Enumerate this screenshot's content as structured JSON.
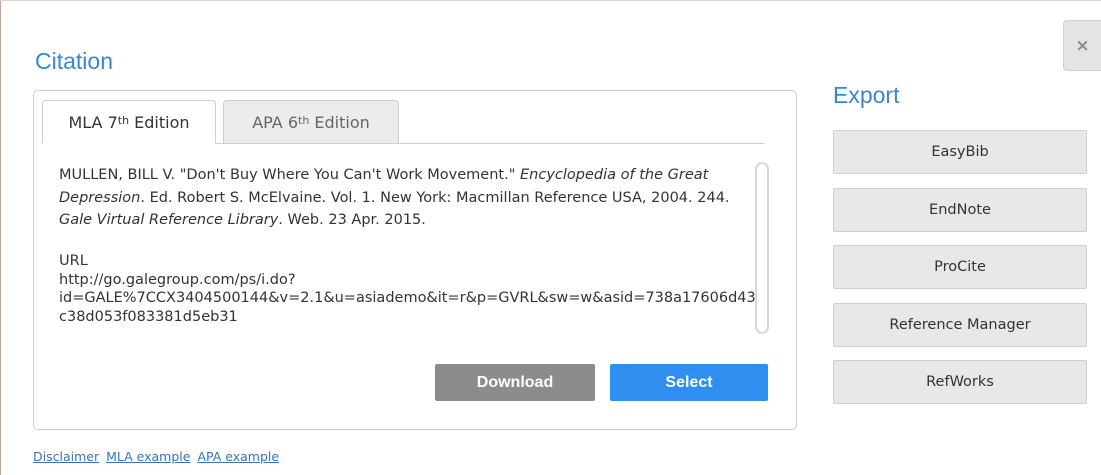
{
  "window": {
    "close_label": "×"
  },
  "citation": {
    "title": "Citation",
    "tabs": [
      {
        "label": "MLA 7",
        "sup": "th",
        "suffix": " Edition",
        "active": true
      },
      {
        "label": "APA 6",
        "sup": "th",
        "suffix": " Edition",
        "active": false
      }
    ],
    "text": {
      "part1": "MULLEN, BILL V. \"Don't Buy Where You Can't Work Movement.\" ",
      "italic1": "Encyclopedia of the Great Depression",
      "part2": ". Ed. Robert S. McElvaine. Vol. 1. New York: Macmillan Reference USA, 2004. 244. ",
      "italic2": "Gale Virtual Reference Library",
      "part3": ". Web. 23 Apr. 2015."
    },
    "url_label": "URL",
    "url_line1": "http://go.galegroup.com/ps/i.do?",
    "url_line2": "id=GALE%7CCX3404500144&v=2.1&u=asiademo&it=r&p=GVRL&sw=w&asid=738a17606d43c38d053f083381d5eb31",
    "download_label": "Download",
    "select_label": "Select"
  },
  "export": {
    "title": "Export",
    "buttons": [
      "EasyBib",
      "EndNote",
      "ProCite",
      "Reference Manager",
      "RefWorks"
    ]
  },
  "footer": {
    "links": [
      "Disclaimer",
      "MLA example",
      "APA example"
    ]
  },
  "colors": {
    "heading": "#3c87c8",
    "select_button": "#2f8ef0",
    "download_button": "#8c8c8c",
    "link": "#3a72b8"
  }
}
